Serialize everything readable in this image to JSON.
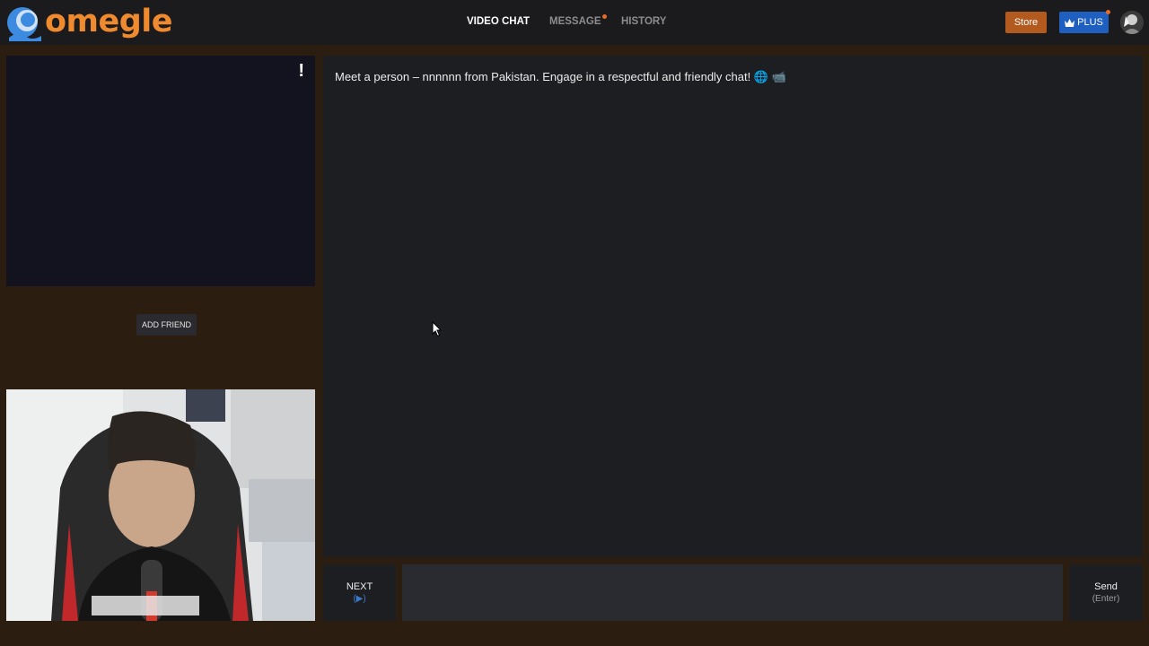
{
  "header": {
    "logo_text": "omegle",
    "nav": {
      "video_chat": "VIDEO CHAT",
      "message": "MESSAGE",
      "history": "HISTORY"
    },
    "store_label": "Store",
    "plus_label": "PLUS"
  },
  "remote": {
    "report_label": "!",
    "add_friend_label": "ADD FRIEND"
  },
  "chat": {
    "message": "Meet a person – nnnnnn from Pakistan. Engage in a respectful and friendly chat! 🌐 📹"
  },
  "controls": {
    "next_label": "NEXT",
    "next_sub": "(▶)",
    "input_value": "",
    "input_placeholder": "",
    "send_label": "Send",
    "send_sub": "(Enter)"
  },
  "icons": {
    "logo": "omegle-logo-icon",
    "crown": "crown-icon",
    "report": "report-icon",
    "avatar": "avatar",
    "cursor": "mouse-cursor-icon"
  },
  "colors": {
    "brand_orange": "#f08a2e",
    "store": "#b35a1f",
    "plus": "#1f5fbf",
    "background": "#2b1d0f",
    "notification": "#e86a2b"
  }
}
